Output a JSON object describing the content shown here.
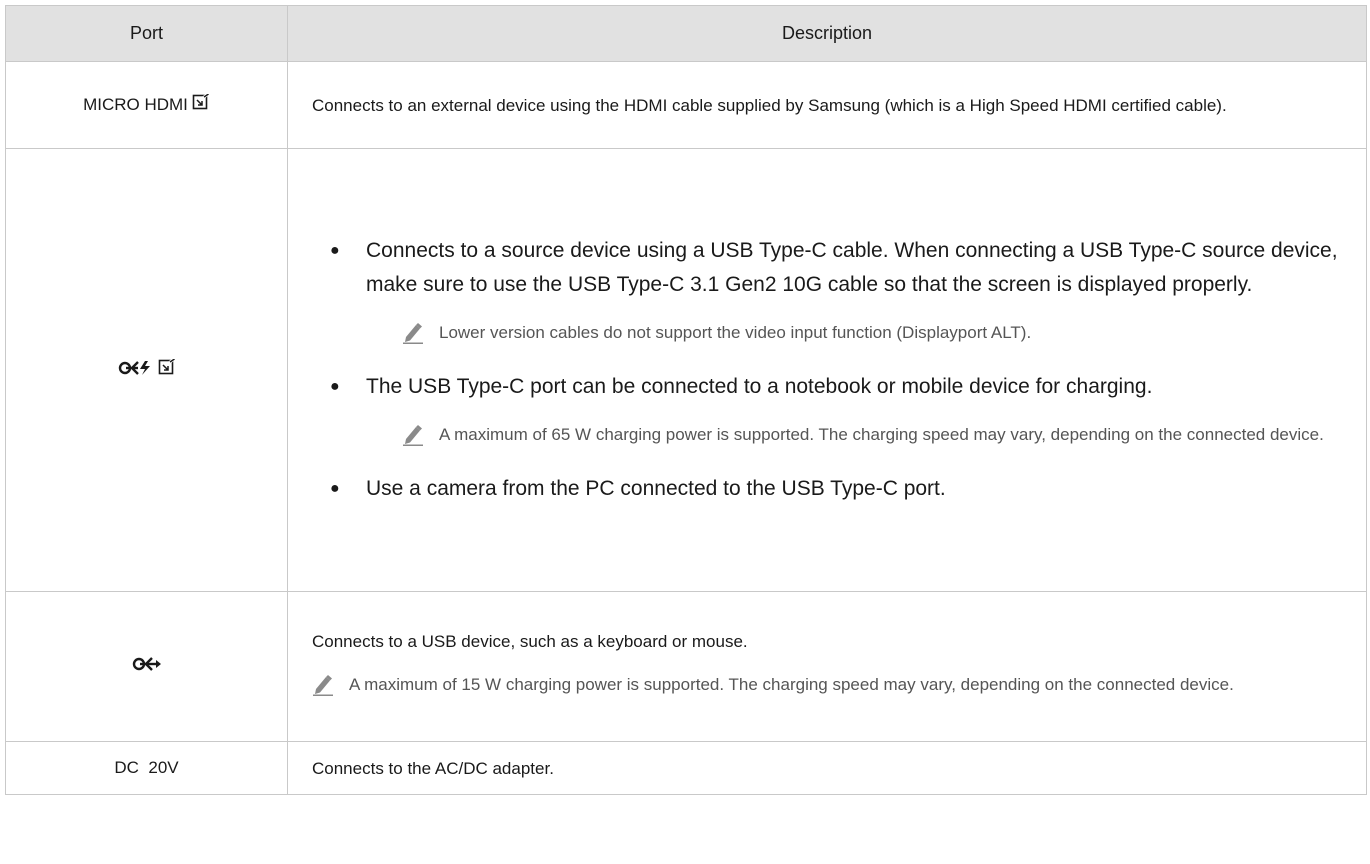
{
  "header": {
    "port": "Port",
    "description": "Description"
  },
  "rows": {
    "hdmi": {
      "port": "MICRO HDMI",
      "port_icon": "hdmi-signal-icon",
      "description": "Connects to an external device using the HDMI cable supplied by Samsung (which is a High Speed HDMI certified cable)."
    },
    "typec": {
      "port_icons": [
        "usb-power-icon",
        "signal-input-icon"
      ],
      "bullet1": "Connects to a source device using a USB Type-C cable. When connecting a USB Type-C source device, make sure to use the USB Type-C 3.1 Gen2 10G cable so that the screen is displayed properly.",
      "note1": "Lower version cables do not support the video input function (Displayport ALT).",
      "bullet2": "The USB Type-C port can be connected to a notebook or mobile device for charging.",
      "note2": "A maximum of 65 W charging power is supported. The charging speed may vary, depending on the connected device.",
      "bullet3": "Use a camera from the PC connected to the USB Type-C port."
    },
    "usb": {
      "port_icon": "usb-icon",
      "description": "Connects to a USB device, such as a keyboard or mouse.",
      "note": "A maximum of 15 W charging power is supported. The charging speed may vary, depending on the connected device."
    },
    "dc": {
      "port": "DC  20V",
      "description": "Connects to the AC/DC adapter."
    }
  }
}
